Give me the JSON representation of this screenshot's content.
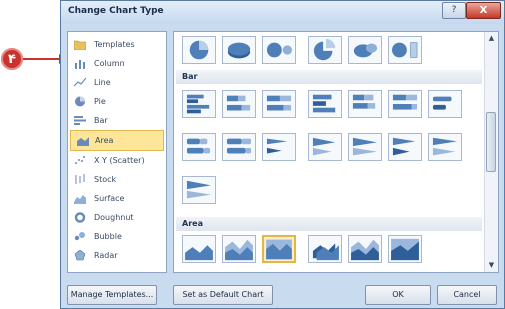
{
  "callout": {
    "number": "۴"
  },
  "dialog": {
    "title": "Change Chart Type",
    "help_glyph": "?",
    "close_glyph": "X"
  },
  "categories": [
    {
      "label": "Templates",
      "icon": "folder-icon"
    },
    {
      "label": "Column",
      "icon": "column-chart-icon"
    },
    {
      "label": "Line",
      "icon": "line-chart-icon"
    },
    {
      "label": "Pie",
      "icon": "pie-chart-icon"
    },
    {
      "label": "Bar",
      "icon": "bar-chart-icon"
    },
    {
      "label": "Area",
      "icon": "area-chart-icon",
      "selected": true
    },
    {
      "label": "X Y (Scatter)",
      "icon": "scatter-chart-icon"
    },
    {
      "label": "Stock",
      "icon": "stock-chart-icon"
    },
    {
      "label": "Surface",
      "icon": "surface-chart-icon"
    },
    {
      "label": "Doughnut",
      "icon": "doughnut-chart-icon"
    },
    {
      "label": "Bubble",
      "icon": "bubble-chart-icon"
    },
    {
      "label": "Radar",
      "icon": "radar-chart-icon"
    }
  ],
  "gallery": {
    "sections": [
      {
        "label": "Bar"
      },
      {
        "label": "Area"
      }
    ]
  },
  "buttons": {
    "manage_templates": "Manage Templates...",
    "set_default": "Set as Default Chart",
    "ok": "OK",
    "cancel": "Cancel"
  },
  "colors": {
    "accent_blue": "#4f7fb8",
    "selection": "#fde69a",
    "callout": "#c8342d"
  }
}
